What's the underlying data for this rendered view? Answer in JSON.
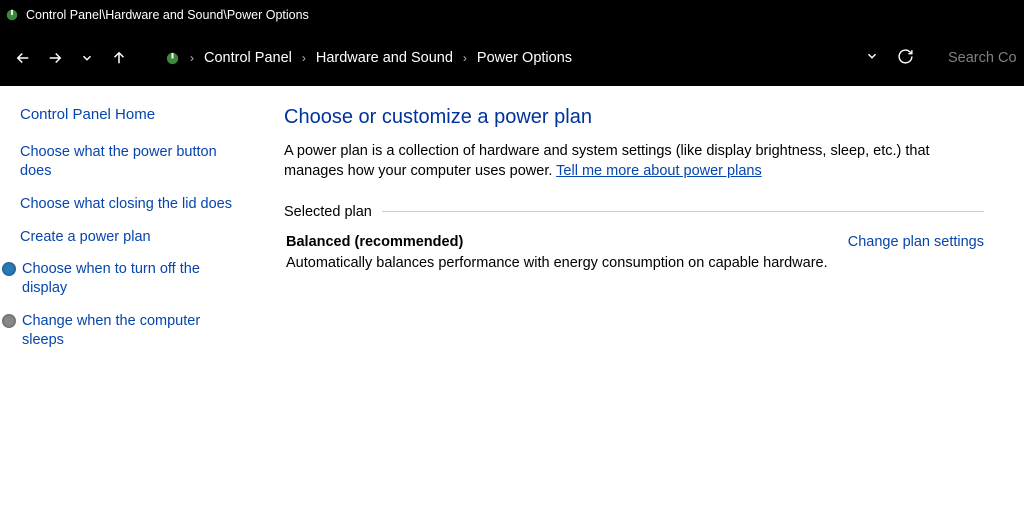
{
  "titlebar": {
    "path": "Control Panel\\Hardware and Sound\\Power Options"
  },
  "breadcrumb": {
    "seg1": "Control Panel",
    "seg2": "Hardware and Sound",
    "seg3": "Power Options"
  },
  "search": {
    "placeholder": "Search Co"
  },
  "sidebar": {
    "home": "Control Panel Home",
    "links": [
      "Choose what the power button does",
      "Choose what closing the lid does",
      "Create a power plan",
      "Choose when to turn off the display",
      "Change when the computer sleeps"
    ]
  },
  "main": {
    "heading": "Choose or customize a power plan",
    "description_prefix": "A power plan is a collection of hardware and system settings (like display brightness, sleep, etc.) that manages how your computer uses power. ",
    "description_link": "Tell me more about power plans",
    "section_label": "Selected plan",
    "plan": {
      "name": "Balanced (recommended)",
      "change_link": "Change plan settings",
      "description": "Automatically balances performance with energy consumption on capable hardware."
    }
  }
}
